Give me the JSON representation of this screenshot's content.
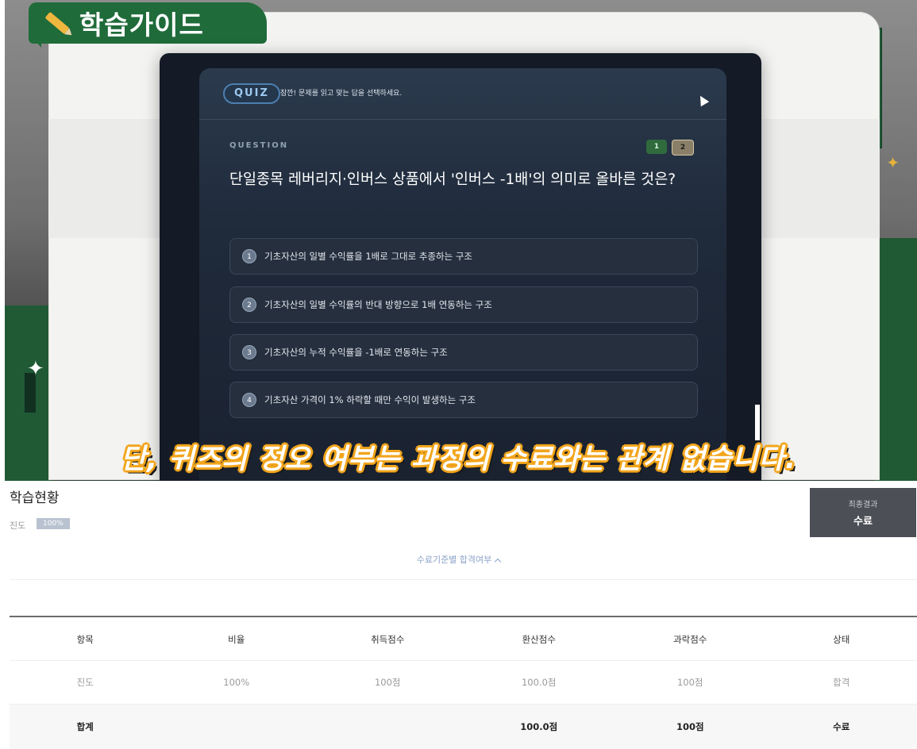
{
  "guide": {
    "title": "학습가이드"
  },
  "quiz": {
    "badge": "QUIZ",
    "instruction": "잠깐! 문제를 읽고 맞는 답을 선택하세요.",
    "question_label": "QUESTION",
    "pages": [
      "1",
      "2"
    ],
    "current_page": "2",
    "question": "단일종목 레버리지·인버스 상품에서 '인버스 -1배'의 의미로 올바른 것은?",
    "options": [
      {
        "num": "1",
        "text": "기초자산의 일별 수익률을 1배로 그대로 추종하는 구조"
      },
      {
        "num": "2",
        "text": "기초자산의 일별 수익률의 반대 방향으로 1배 연동하는 구조"
      },
      {
        "num": "3",
        "text": "기초자산의 누적 수익률을 -1배로 연동하는 구조"
      },
      {
        "num": "4",
        "text": "기초자산 가격이 1% 하락할 때만 수익이 발생하는 구조"
      }
    ]
  },
  "subtitle": "단, 퀴즈의 정오 여부는 과정의 수료와는 관계 없습니다.",
  "status": {
    "title": "학습현황",
    "progress_label": "진도",
    "progress_value": "100%",
    "progress_fraction": 1.0,
    "final_label": "최종결과",
    "final_value": "수료",
    "criteria_toggle": "수료기준별 합격여부"
  },
  "table": {
    "headers": [
      "항목",
      "비율",
      "취득점수",
      "환산점수",
      "과락점수",
      "상태"
    ],
    "rows": [
      [
        "진도",
        "100%",
        "100점",
        "100.0점",
        "100점",
        "합격"
      ]
    ],
    "total": [
      "합계",
      "",
      "",
      "100.0점",
      "100점",
      "수료"
    ]
  },
  "colors": {
    "guide_green": "#1f6b3a",
    "subtitle_outline": "#f2a51c",
    "final_box": "#4c4f56",
    "progress_badge": "#b9c2d0"
  }
}
